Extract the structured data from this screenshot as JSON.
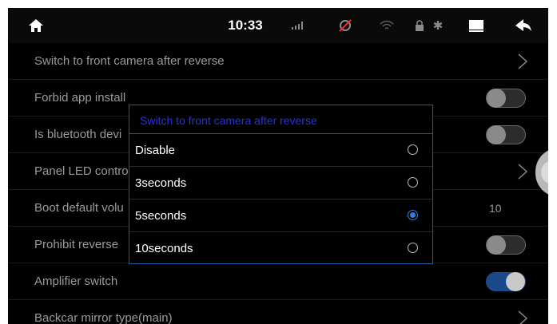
{
  "status_bar": {
    "time": "10:33",
    "icons": [
      "home-icon",
      "signal-icon",
      "gps-off-icon",
      "wifi-icon",
      "lock-icon",
      "bluetooth-icon",
      "screen-icon",
      "back-icon"
    ],
    "bluetooth_glyph": "✱"
  },
  "settings": {
    "rows": [
      {
        "label": "Switch to front camera after reverse",
        "control": "chevron"
      },
      {
        "label": "Forbid app install",
        "control": "toggle",
        "on": false
      },
      {
        "label": "Is bluetooth devi",
        "control": "toggle",
        "on": false
      },
      {
        "label": "Panel LED contro",
        "control": "chevron"
      },
      {
        "label": "Boot default volu",
        "control": "value",
        "value": "10"
      },
      {
        "label": "Prohibit reverse",
        "control": "toggle",
        "on": false
      },
      {
        "label": "Amplifier switch",
        "control": "toggle",
        "on": true
      },
      {
        "label": "Backcar mirror type(main)",
        "control": "chevron"
      }
    ]
  },
  "dialog": {
    "title": "Switch to front camera after reverse",
    "options": [
      {
        "label": "Disable",
        "selected": false
      },
      {
        "label": "3seconds",
        "selected": false
      },
      {
        "label": "5seconds",
        "selected": true
      },
      {
        "label": "10seconds",
        "selected": false
      }
    ]
  },
  "colors": {
    "accent": "#2f7de1",
    "dialog_border": "#1e5aa0",
    "dialog_title": "#2233dd",
    "toggle_on": "#1a4a8a"
  }
}
